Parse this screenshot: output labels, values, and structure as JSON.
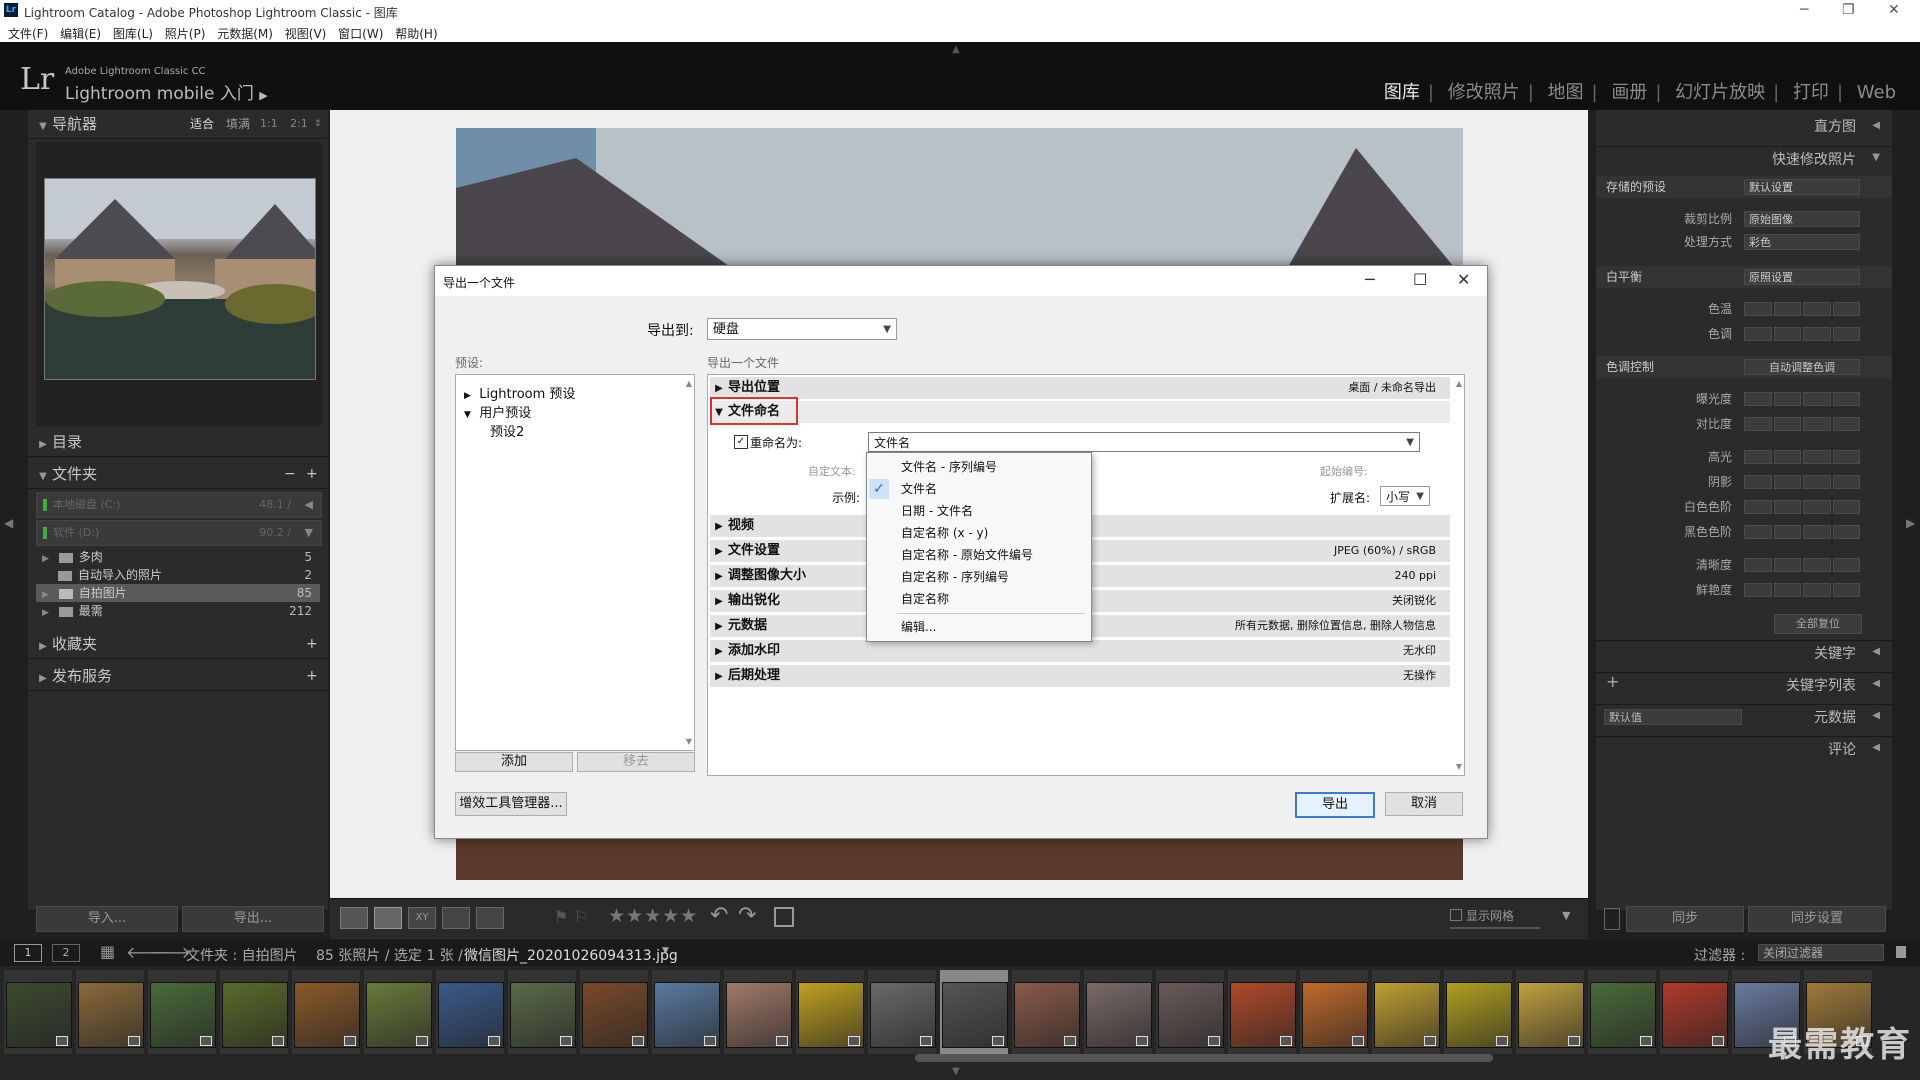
{
  "window": {
    "title": "Lightroom Catalog - Adobe Photoshop Lightroom Classic - 图库",
    "app_icon": "Lr"
  },
  "menu": [
    "文件(F)",
    "编辑(E)",
    "图库(L)",
    "照片(P)",
    "元数据(M)",
    "视图(V)",
    "窗口(W)",
    "帮助(H)"
  ],
  "header": {
    "logo": "Lr",
    "brand_line1": "Adobe Lightroom Classic CC",
    "brand_line2": "Lightroom mobile 入门",
    "modules": [
      "图库",
      "修改照片",
      "地图",
      "画册",
      "幻灯片放映",
      "打印",
      "Web"
    ],
    "active_module": "图库"
  },
  "left_panel": {
    "navigator": {
      "title": "导航器",
      "zoom_options": [
        "适合",
        "填满",
        "1:1",
        "2:1"
      ]
    },
    "catalog_title": "目录",
    "folders": {
      "title": "文件夹",
      "drives": [
        {
          "label": "本地磁盘 (C:)",
          "space": "48.1 /"
        },
        {
          "label": "软件 (D:)",
          "space": "90.2 /"
        }
      ],
      "items": [
        {
          "name": "多肉",
          "count": "5"
        },
        {
          "name": "自动导入的照片",
          "count": "2"
        },
        {
          "name": "自拍图片",
          "count": "85",
          "selected": true
        },
        {
          "name": "最需",
          "count": "212"
        }
      ]
    },
    "collections_title": "收藏夹",
    "publish_title": "发布服务",
    "import_label": "导入...",
    "export_label": "导出..."
  },
  "right_panel": {
    "histogram": "直方图",
    "quick_develop": "快速修改照片",
    "saved_preset_label": "存储的预设",
    "saved_preset_value": "默认设置",
    "crop_label": "裁剪比例",
    "crop_value": "原始图像",
    "treatment_label": "处理方式",
    "treatment_value": "彩色",
    "wb_label": "白平衡",
    "wb_value": "原照设置",
    "temp_label": "色温",
    "tint_label": "色调",
    "tone_label": "色调控制",
    "auto_tone": "自动调整色调",
    "tone_rows": [
      "曝光度",
      "对比度",
      "高光",
      "阴影",
      "白色色阶",
      "黑色色阶",
      "清晰度",
      "鲜艳度"
    ],
    "reset_all": "全部复位",
    "keywords": "关键字",
    "keyword_list": "关键字列表",
    "metadata_preset": "默认值",
    "metadata": "元数据",
    "comments": "评论",
    "sync": "同步",
    "sync_settings": "同步设置"
  },
  "toolbar": {
    "show_grid": "显示网格"
  },
  "filmstrip": {
    "page1": "1",
    "page2": "2",
    "path": "文件夹 : 自拍图片",
    "count_info": "85 张照片 / 选定 1 张 /",
    "filename": "微信图片_20201026094313.jpg",
    "filter_label": "过滤器 :",
    "filter_value": "关闭过滤器",
    "thumb_colors": [
      "#3b4a2f",
      "#8a6a3a",
      "#4a6a3a",
      "#5a6a2a",
      "#8a5a2a",
      "#6a7a3a",
      "#3a5a8a",
      "#5a6a4a",
      "#7a4a2a",
      "#5a7aa0",
      "#a07a6a",
      "#c0a020",
      "#6a6a6a",
      "#555",
      "#8a5a4a",
      "#7a6a6a",
      "#6a5a5a",
      "#b04a2a",
      "#c06a2a",
      "#c0a030",
      "#b0a020",
      "#c0a040",
      "#4a6a3a",
      "#b03a2a",
      "#6a7aa0",
      "#a07a3a"
    ]
  },
  "dialog": {
    "title": "导出一个文件",
    "export_to_label": "导出到:",
    "export_to_value": "硬盘",
    "presets_label": "预设:",
    "section_header": "导出一个文件",
    "preset_tree": [
      {
        "label": "Lightroom 预设",
        "expanded": false
      },
      {
        "label": "用户预设",
        "expanded": true
      },
      {
        "label": "预设2",
        "child": true
      }
    ],
    "add_label": "添加",
    "remove_label": "移去",
    "plugin_manager": "增效工具管理器...",
    "export_label": "导出",
    "cancel_label": "取消",
    "location": {
      "title": "导出位置",
      "value": "桌面 / 未命名导出"
    },
    "naming": {
      "title": "文件命名",
      "rename_label": "重命名为:",
      "rename_value": "文件名",
      "custom_text_label": "自定文本:",
      "start_number_label": "起始编号:",
      "example_label": "示例:",
      "extension_label": "扩展名:",
      "extension_value": "小写"
    },
    "sections": [
      {
        "title": "视频",
        "value": ""
      },
      {
        "title": "文件设置",
        "value": "JPEG (60%) / sRGB"
      },
      {
        "title": "调整图像大小",
        "value": "240 ppi"
      },
      {
        "title": "输出锐化",
        "value": "关闭锐化"
      },
      {
        "title": "元数据",
        "value": "所有元数据, 删除位置信息, 删除人物信息"
      },
      {
        "title": "添加水印",
        "value": "无水印"
      },
      {
        "title": "后期处理",
        "value": "无操作"
      }
    ],
    "dropdown_options": [
      "文件名 - 序列编号",
      "文件名",
      "日期 - 文件名",
      "自定名称 (x - y)",
      "自定名称 - 原始文件编号",
      "自定名称 - 序列编号",
      "自定名称",
      "编辑..."
    ],
    "dropdown_selected": "文件名"
  },
  "watermark": "最需教育",
  "colors": {
    "accent_red": "#e0302a",
    "selection_blue": "#3a7bd5"
  }
}
